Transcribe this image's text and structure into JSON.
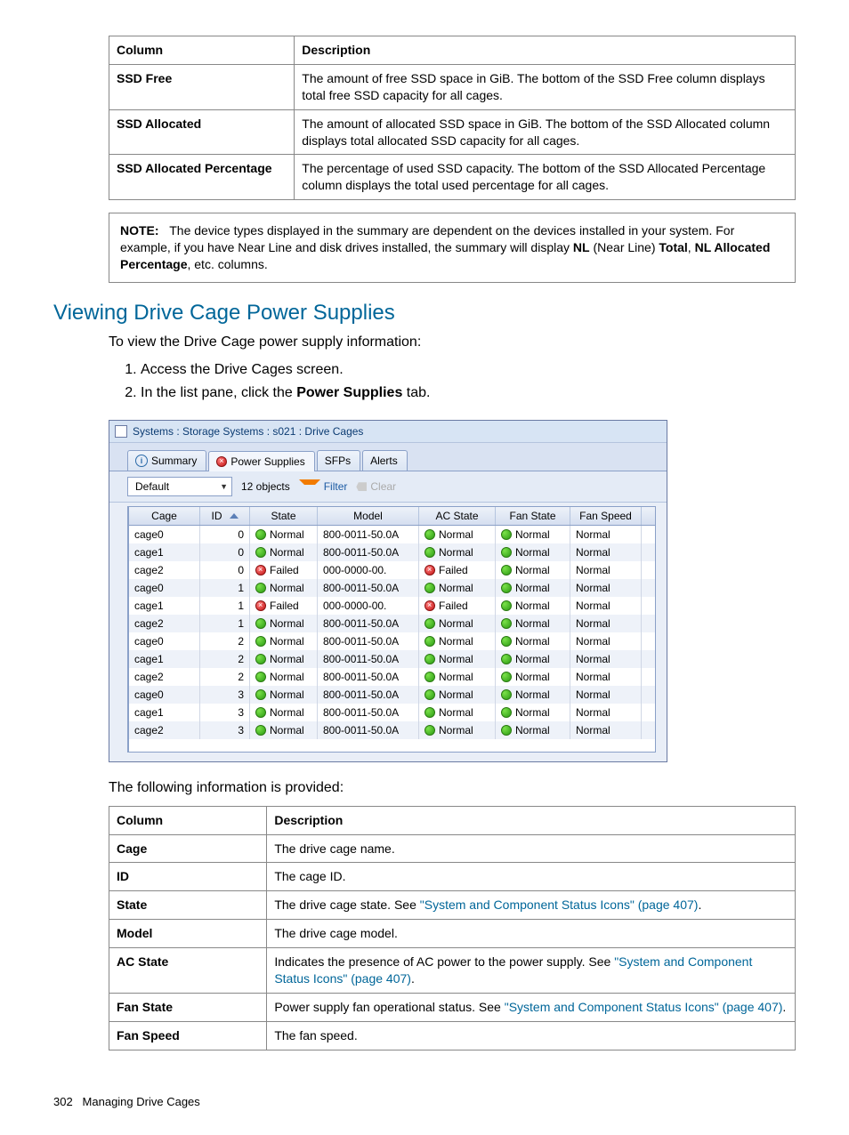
{
  "table1": {
    "headers": [
      "Column",
      "Description"
    ],
    "rows": [
      {
        "col": "SSD Free",
        "desc": "The amount of free SSD space in GiB. The bottom of the SSD Free column displays total free SSD capacity for all cages."
      },
      {
        "col": "SSD Allocated",
        "desc": "The amount of allocated SSD space in GiB. The bottom of the SSD Allocated column displays total allocated SSD capacity for all cages."
      },
      {
        "col": "SSD Allocated Percentage",
        "desc": "The percentage of used SSD capacity. The bottom of the SSD Allocated Percentage column displays the total used percentage for all cages."
      }
    ]
  },
  "note": {
    "label": "NOTE:",
    "text1": "The device types displayed in the summary are dependent on the devices installed in your system. For example, if you have Near Line and disk drives installed, the summary will display ",
    "bold1": "NL",
    "text2": " (Near Line) ",
    "bold2": "Total",
    "text3": ", ",
    "bold3": "NL Allocated Percentage",
    "text4": ", etc. columns."
  },
  "section_title": "Viewing Drive Cage Power Supplies",
  "intro": "To view the Drive Cage power supply information:",
  "steps": {
    "s1": "Access the Drive Cages screen.",
    "s2a": "In the list pane, click the ",
    "s2b": "Power Supplies",
    "s2c": " tab."
  },
  "app": {
    "title": "Systems : Storage Systems : s021 : Drive Cages",
    "tabs": {
      "summary": "Summary",
      "power": "Power Supplies",
      "sfps": "SFPs",
      "alerts": "Alerts"
    },
    "filterbar": {
      "default": "Default",
      "count": "12 objects",
      "filter": "Filter",
      "clear": "Clear"
    },
    "headers": {
      "cage": "Cage",
      "id": "ID",
      "state": "State",
      "model": "Model",
      "ac": "AC State",
      "fan": "Fan State",
      "speed": "Fan Speed"
    },
    "rows": [
      {
        "cage": "cage0",
        "id": "0",
        "state": "Normal",
        "stok": true,
        "model": "800-0011-50.0A",
        "ac": "Normal",
        "acok": true,
        "fan": "Normal",
        "speed": "Normal"
      },
      {
        "cage": "cage1",
        "id": "0",
        "state": "Normal",
        "stok": true,
        "model": "800-0011-50.0A",
        "ac": "Normal",
        "acok": true,
        "fan": "Normal",
        "speed": "Normal"
      },
      {
        "cage": "cage2",
        "id": "0",
        "state": "Failed",
        "stok": false,
        "model": "000-0000-00.",
        "ac": "Failed",
        "acok": false,
        "fan": "Normal",
        "speed": "Normal"
      },
      {
        "cage": "cage0",
        "id": "1",
        "state": "Normal",
        "stok": true,
        "model": "800-0011-50.0A",
        "ac": "Normal",
        "acok": true,
        "fan": "Normal",
        "speed": "Normal"
      },
      {
        "cage": "cage1",
        "id": "1",
        "state": "Failed",
        "stok": false,
        "model": "000-0000-00.",
        "ac": "Failed",
        "acok": false,
        "fan": "Normal",
        "speed": "Normal"
      },
      {
        "cage": "cage2",
        "id": "1",
        "state": "Normal",
        "stok": true,
        "model": "800-0011-50.0A",
        "ac": "Normal",
        "acok": true,
        "fan": "Normal",
        "speed": "Normal"
      },
      {
        "cage": "cage0",
        "id": "2",
        "state": "Normal",
        "stok": true,
        "model": "800-0011-50.0A",
        "ac": "Normal",
        "acok": true,
        "fan": "Normal",
        "speed": "Normal"
      },
      {
        "cage": "cage1",
        "id": "2",
        "state": "Normal",
        "stok": true,
        "model": "800-0011-50.0A",
        "ac": "Normal",
        "acok": true,
        "fan": "Normal",
        "speed": "Normal"
      },
      {
        "cage": "cage2",
        "id": "2",
        "state": "Normal",
        "stok": true,
        "model": "800-0011-50.0A",
        "ac": "Normal",
        "acok": true,
        "fan": "Normal",
        "speed": "Normal"
      },
      {
        "cage": "cage0",
        "id": "3",
        "state": "Normal",
        "stok": true,
        "model": "800-0011-50.0A",
        "ac": "Normal",
        "acok": true,
        "fan": "Normal",
        "speed": "Normal"
      },
      {
        "cage": "cage1",
        "id": "3",
        "state": "Normal",
        "stok": true,
        "model": "800-0011-50.0A",
        "ac": "Normal",
        "acok": true,
        "fan": "Normal",
        "speed": "Normal"
      },
      {
        "cage": "cage2",
        "id": "3",
        "state": "Normal",
        "stok": true,
        "model": "800-0011-50.0A",
        "ac": "Normal",
        "acok": true,
        "fan": "Normal",
        "speed": "Normal"
      }
    ]
  },
  "para2": "The following information is provided:",
  "table2": {
    "headers": [
      "Column",
      "Description"
    ],
    "rows": [
      {
        "col": "Cage",
        "desc": "The drive cage name."
      },
      {
        "col": "ID",
        "desc": "The cage ID."
      },
      {
        "col": "State",
        "pre": "The drive cage state. See ",
        "link": "\"System and Component Status Icons\" (page 407)",
        "post": "."
      },
      {
        "col": "Model",
        "desc": "The drive cage model."
      },
      {
        "col": "AC State",
        "pre": "Indicates the presence of AC power to the power supply. See ",
        "link": "\"System and Component Status Icons\" (page 407)",
        "post": "."
      },
      {
        "col": "Fan State",
        "pre": "Power supply fan operational status. See ",
        "link": "\"System and Component Status Icons\" (page 407)",
        "post": "."
      },
      {
        "col": "Fan Speed",
        "desc": "The fan speed."
      }
    ]
  },
  "footer": {
    "page": "302",
    "title": "Managing Drive Cages"
  }
}
